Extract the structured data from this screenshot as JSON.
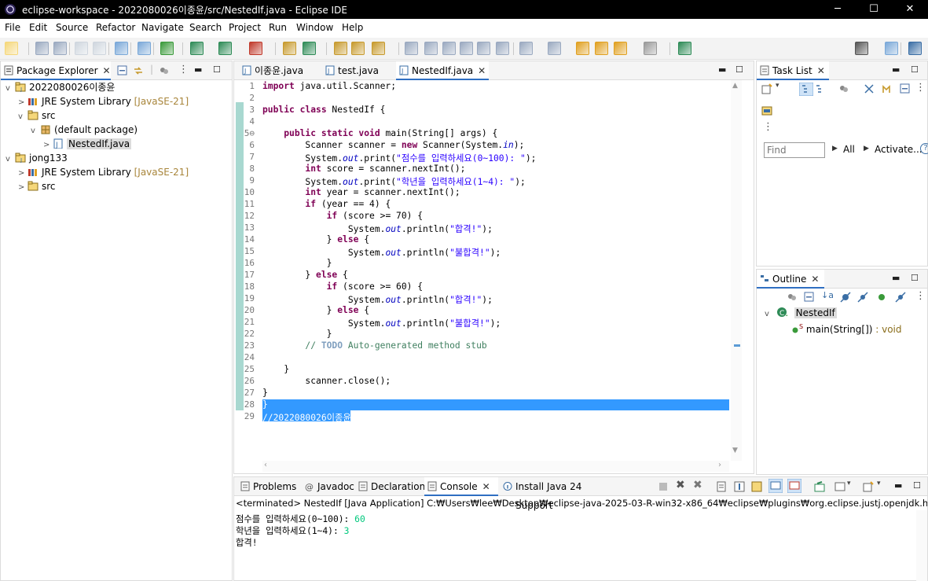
{
  "window": {
    "title": "eclipse-workspace - 2022080026이종윤/src/NestedIf.java - Eclipse IDE"
  },
  "menu": [
    "File",
    "Edit",
    "Source",
    "Refactor",
    "Navigate",
    "Search",
    "Project",
    "Run",
    "Window",
    "Help"
  ],
  "package_explorer": {
    "tab": "Package Explorer",
    "tree": [
      {
        "label": "2022080026이종윤",
        "indent": 0,
        "chev": "v",
        "icon": "project"
      },
      {
        "label": "JRE System Library",
        "deco": "[JavaSE-21]",
        "indent": 1,
        "chev": ">",
        "icon": "library"
      },
      {
        "label": "src",
        "indent": 1,
        "chev": "v",
        "icon": "folder"
      },
      {
        "label": "(default package)",
        "indent": 2,
        "chev": "v",
        "icon": "package"
      },
      {
        "label": "NestedIf.java",
        "indent": 3,
        "chev": ">",
        "icon": "java",
        "selected": true
      },
      {
        "label": "jong133",
        "indent": 0,
        "chev": "v",
        "icon": "project"
      },
      {
        "label": "JRE System Library",
        "deco": "[JavaSE-21]",
        "indent": 1,
        "chev": ">",
        "icon": "library"
      },
      {
        "label": "src",
        "indent": 1,
        "chev": ">",
        "icon": "folder"
      }
    ]
  },
  "editor": {
    "tabs": [
      {
        "label": "이종윤.java",
        "active": false
      },
      {
        "label": "test.java",
        "active": false
      },
      {
        "label": "NestedIf.java",
        "active": true
      }
    ],
    "line_numbers": [
      "1",
      "2",
      "3",
      "4",
      "5⊖",
      "6",
      "7",
      "8",
      "9",
      "10",
      "11",
      "12",
      "13",
      "14",
      "15",
      "16",
      "17",
      "18",
      "19",
      "20",
      "21",
      "22",
      "23",
      "24",
      "25",
      "26",
      "27",
      "28",
      "29"
    ],
    "lines": [
      [
        [
          "kw",
          "import"
        ],
        [
          "",
          "java.util.Scanner;"
        ]
      ],
      [],
      [
        [
          "kw",
          "public class"
        ],
        [
          "",
          " NestedIf {"
        ]
      ],
      [],
      [
        [
          "",
          "    "
        ],
        [
          "kw",
          "public static void"
        ],
        [
          "",
          " main(String[] args) {"
        ]
      ],
      [
        [
          "",
          "        Scanner scanner = "
        ],
        [
          "kw",
          "new"
        ],
        [
          "",
          " Scanner(System."
        ],
        [
          "fld",
          "in"
        ],
        [
          "",
          ");"
        ]
      ],
      [
        [
          "",
          "        System."
        ],
        [
          "fld",
          "out"
        ],
        [
          "",
          ".print("
        ],
        [
          "str",
          "\"점수를 입력하세요(0~100): \""
        ],
        [
          "",
          ");"
        ]
      ],
      [
        [
          "",
          "        "
        ],
        [
          "kw",
          "int"
        ],
        [
          "",
          " score = scanner.nextInt();"
        ]
      ],
      [
        [
          "",
          "        System."
        ],
        [
          "fld",
          "out"
        ],
        [
          "",
          ".print("
        ],
        [
          "str",
          "\"학년을 입력하세요(1~4): \""
        ],
        [
          "",
          ");"
        ]
      ],
      [
        [
          "",
          "        "
        ],
        [
          "kw",
          "int"
        ],
        [
          "",
          " year = scanner.nextInt();"
        ]
      ],
      [
        [
          "",
          "        "
        ],
        [
          "kw",
          "if"
        ],
        [
          "",
          " (year == 4) {"
        ]
      ],
      [
        [
          "",
          "            "
        ],
        [
          "kw",
          "if"
        ],
        [
          "",
          " (score >= 70) {"
        ]
      ],
      [
        [
          "",
          "                System."
        ],
        [
          "fld",
          "out"
        ],
        [
          "",
          ".println("
        ],
        [
          "str",
          "\"합격!\""
        ],
        [
          "",
          ");"
        ]
      ],
      [
        [
          "",
          "            } "
        ],
        [
          "kw",
          "else"
        ],
        [
          "",
          " {"
        ]
      ],
      [
        [
          "",
          "                System."
        ],
        [
          "fld",
          "out"
        ],
        [
          "",
          ".println("
        ],
        [
          "str",
          "\"불합격!\""
        ],
        [
          "",
          ");"
        ]
      ],
      [
        [
          "",
          "            }"
        ]
      ],
      [
        [
          "",
          "        } "
        ],
        [
          "kw",
          "else"
        ],
        [
          "",
          " {"
        ]
      ],
      [
        [
          "",
          "            "
        ],
        [
          "kw",
          "if"
        ],
        [
          "",
          " (score >= 60) {"
        ]
      ],
      [
        [
          "",
          "                System."
        ],
        [
          "fld",
          "out"
        ],
        [
          "",
          ".println("
        ],
        [
          "str",
          "\"합격!\""
        ],
        [
          "",
          ");"
        ]
      ],
      [
        [
          "",
          "            } "
        ],
        [
          "kw",
          "else"
        ],
        [
          "",
          " {"
        ]
      ],
      [
        [
          "",
          "                System."
        ],
        [
          "fld",
          "out"
        ],
        [
          "",
          ".println("
        ],
        [
          "str",
          "\"불합격!\""
        ],
        [
          "",
          ");"
        ]
      ],
      [
        [
          "",
          "            }"
        ]
      ],
      [
        [
          "cm",
          "        // "
        ],
        [
          "tag",
          "TODO"
        ],
        [
          "cm",
          " Auto-generated method stub"
        ]
      ],
      [],
      [
        [
          "",
          "    }"
        ]
      ],
      [
        [
          "",
          "        scanner.close();"
        ]
      ],
      [
        [
          "",
          "}"
        ]
      ],
      [
        [
          "",
          "}"
        ]
      ],
      [
        [
          "cm",
          "//2022080026이종윤"
        ]
      ]
    ]
  },
  "task_list": {
    "tab": "Task List",
    "find_placeholder": "Find",
    "all": "All",
    "activate": "Activate..."
  },
  "outline": {
    "tab": "Outline",
    "class_name": "NestedIf",
    "method": "main(String[])",
    "method_type": " : void"
  },
  "console": {
    "tabs": [
      "Problems",
      "Javadoc",
      "Declaration",
      "Console",
      "Install Java 24 Support"
    ],
    "status": "<terminated> NestedIf [Java Application] C:₩Users₩lee₩Desktop₩eclipse-java-2025-03-R-win32-x86_64₩eclipse₩plugins₩org.eclipse.justj.openjdk.hotspot.jre.full.w",
    "lines": [
      {
        "prompt": "점수를 입력하세요(0~100): ",
        "input": "60"
      },
      {
        "prompt": "학년을 입력하세요(1~4): ",
        "input": "3"
      },
      {
        "prompt": "합격!",
        "input": ""
      }
    ]
  },
  "colors": {
    "keyword": "#7f0055",
    "string": "#2a00ff",
    "field": "#0000c0",
    "comment": "#3f7f5f",
    "selection": "#3399ff",
    "console_input": "#00c87d"
  }
}
